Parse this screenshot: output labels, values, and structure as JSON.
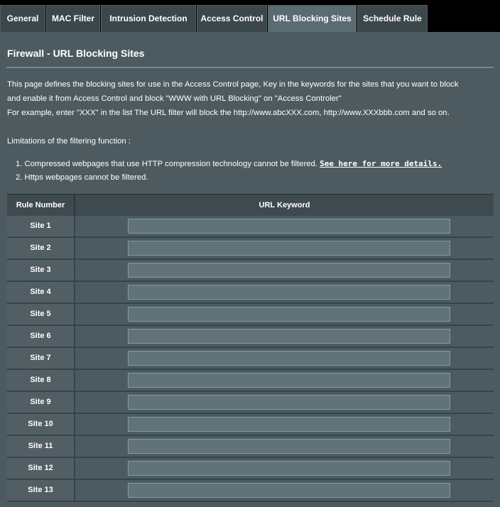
{
  "tabs": [
    {
      "label": "General"
    },
    {
      "label": "MAC Filter"
    },
    {
      "label": "Intrusion Detection"
    },
    {
      "label": "Access Control"
    },
    {
      "label": "URL Blocking Sites"
    },
    {
      "label": "Schedule Rule"
    }
  ],
  "active_tab": "URL Blocking Sites",
  "page": {
    "title": "Firewall - URL Blocking Sites",
    "desc_line1": "This page defines the blocking sites for use in the Access Control page, Key in the keywords for the sites that you want to block",
    "desc_line2": "and enable it from Access Control and block \"WWW with URL Blocking\" on \"Access Controler\"",
    "desc_line3": "For example, enter \"XXX\" in the list The URL filter will block the http://www.abcXXX.com, http://www.XXXbbb.com and so on.",
    "limitations_heading": "Limitations of the filtering function :",
    "limitation1_text": "1.  Compressed webpages that use HTTP compression technology cannot be filtered. ",
    "limitation1_link": "See here for more details.",
    "limitation2_text": "2.  Https webpages cannot be filtered."
  },
  "table": {
    "col_rule": "Rule Number",
    "col_keyword": "URL Keyword",
    "rows": [
      {
        "label": "Site  1",
        "value": ""
      },
      {
        "label": "Site  2",
        "value": ""
      },
      {
        "label": "Site  3",
        "value": ""
      },
      {
        "label": "Site  4",
        "value": ""
      },
      {
        "label": "Site  5",
        "value": ""
      },
      {
        "label": "Site  6",
        "value": ""
      },
      {
        "label": "Site  7",
        "value": ""
      },
      {
        "label": "Site  8",
        "value": ""
      },
      {
        "label": "Site  9",
        "value": ""
      },
      {
        "label": "Site  10",
        "value": ""
      },
      {
        "label": "Site  11",
        "value": ""
      },
      {
        "label": "Site  12",
        "value": ""
      },
      {
        "label": "Site  13",
        "value": ""
      }
    ]
  }
}
